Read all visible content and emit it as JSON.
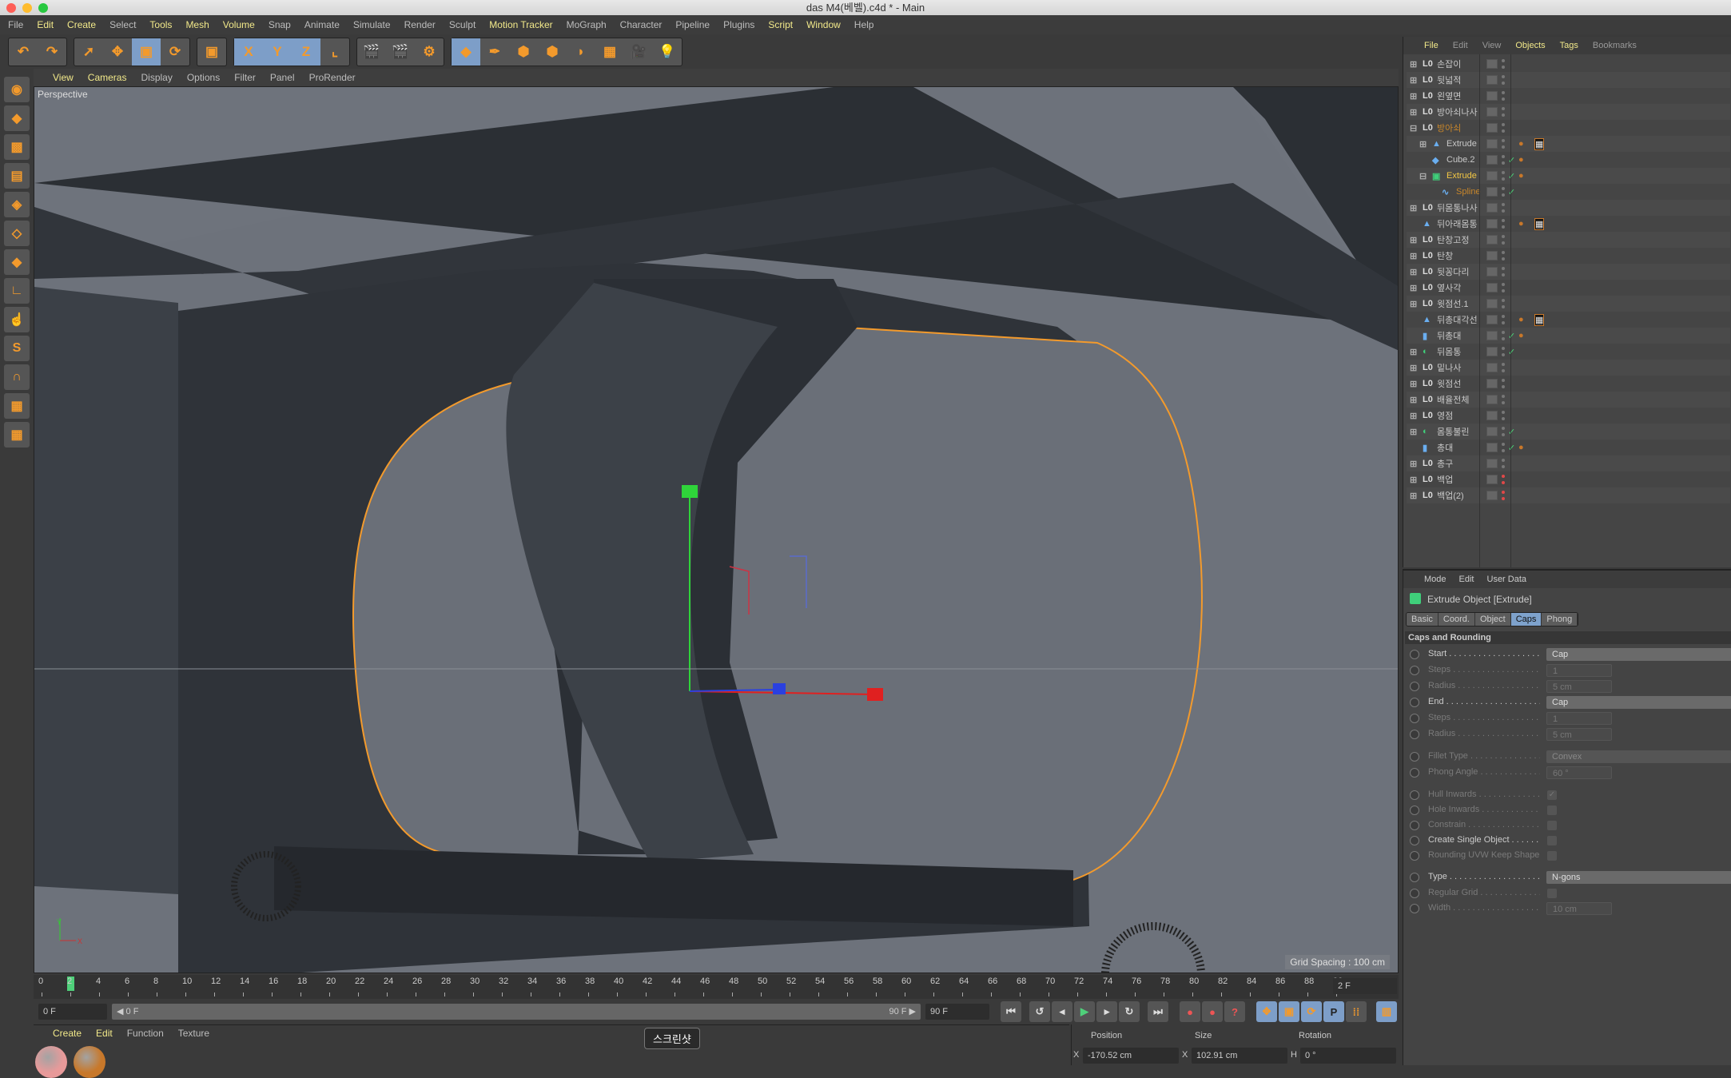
{
  "window": {
    "title": "das M4(베벨).c4d * - Main"
  },
  "menu": [
    {
      "label": "File",
      "hl": false
    },
    {
      "label": "Edit",
      "hl": true
    },
    {
      "label": "Create",
      "hl": true
    },
    {
      "label": "Select",
      "hl": false
    },
    {
      "label": "Tools",
      "hl": true
    },
    {
      "label": "Mesh",
      "hl": true
    },
    {
      "label": "Volume",
      "hl": true
    },
    {
      "label": "Snap",
      "hl": false
    },
    {
      "label": "Animate",
      "hl": false
    },
    {
      "label": "Simulate",
      "hl": false
    },
    {
      "label": "Render",
      "hl": false
    },
    {
      "label": "Sculpt",
      "hl": false
    },
    {
      "label": "Motion Tracker",
      "hl": true
    },
    {
      "label": "MoGraph",
      "hl": false
    },
    {
      "label": "Character",
      "hl": false
    },
    {
      "label": "Pipeline",
      "hl": false
    },
    {
      "label": "Plugins",
      "hl": false
    },
    {
      "label": "Script",
      "hl": true
    },
    {
      "label": "Window",
      "hl": true
    },
    {
      "label": "Help",
      "hl": false
    }
  ],
  "toolbar": {
    "groups": [
      [
        {
          "icon": "undo-icon",
          "g": "↶"
        },
        {
          "icon": "redo-icon",
          "g": "↷"
        }
      ],
      [
        {
          "icon": "live-selection-icon",
          "g": "➚"
        },
        {
          "icon": "move-icon",
          "g": "✥"
        },
        {
          "icon": "scale-icon",
          "g": "▣",
          "on": true
        },
        {
          "icon": "rotate-icon",
          "g": "⟳"
        }
      ],
      [
        {
          "icon": "recent-tool-icon",
          "g": "▣"
        }
      ],
      [
        {
          "icon": "x-axis-lock-icon",
          "g": "X",
          "on": true
        },
        {
          "icon": "y-axis-lock-icon",
          "g": "Y",
          "on": true
        },
        {
          "icon": "z-axis-lock-icon",
          "g": "Z",
          "on": true
        },
        {
          "icon": "coordinate-system-icon",
          "g": "⌞"
        }
      ],
      [
        {
          "icon": "render-view-icon",
          "g": "🎬"
        },
        {
          "icon": "render-picture-viewer-icon",
          "g": "🎬"
        },
        {
          "icon": "render-settings-icon",
          "g": "⚙"
        }
      ],
      [
        {
          "icon": "cube-object-icon",
          "g": "◆",
          "on": true
        },
        {
          "icon": "pen-spline-icon",
          "g": "✒"
        },
        {
          "icon": "subdivision-surface-icon",
          "g": "⬢"
        },
        {
          "icon": "cloner-icon",
          "g": "⬢"
        },
        {
          "icon": "deformer-icon",
          "g": "◗"
        },
        {
          "icon": "floor-icon",
          "g": "▦"
        },
        {
          "icon": "camera-icon",
          "g": "🎥"
        },
        {
          "icon": "light-icon",
          "g": "💡"
        }
      ]
    ]
  },
  "left_tools": [
    {
      "icon": "make-editable-icon",
      "g": "◉"
    },
    {
      "icon": "model-mode-icon",
      "g": "◆"
    },
    {
      "icon": "texture-mode-icon",
      "g": "▩"
    },
    {
      "icon": "workplane-icon",
      "g": "▤"
    },
    {
      "icon": "points-mode-icon",
      "g": "◈"
    },
    {
      "icon": "edges-mode-icon",
      "g": "◇"
    },
    {
      "icon": "polygons-mode-icon",
      "g": "◆"
    },
    {
      "icon": "axis-mode-icon",
      "g": "∟"
    },
    {
      "icon": "tweak-mode-icon",
      "g": "☝"
    },
    {
      "icon": "snap-icon",
      "g": "S"
    },
    {
      "icon": "magnet-icon",
      "g": "∩"
    },
    {
      "icon": "lock-workplane-icon",
      "g": "▦"
    },
    {
      "icon": "planar-workplane-icon",
      "g": "▦"
    }
  ],
  "viewport": {
    "menu": [
      {
        "label": "View",
        "hl": true
      },
      {
        "label": "Cameras",
        "hl": true
      },
      {
        "label": "Display",
        "hl": false
      },
      {
        "label": "Options",
        "hl": false
      },
      {
        "label": "Filter",
        "hl": false
      },
      {
        "label": "Panel",
        "hl": false
      },
      {
        "label": "ProRender",
        "hl": false
      }
    ],
    "label": "Perspective",
    "grid_spacing": "Grid Spacing : 100 cm",
    "axis_y": "Y",
    "axis_x": "X"
  },
  "timeline": {
    "ticks": [
      "0",
      "2",
      "4",
      "6",
      "8",
      "10",
      "12",
      "14",
      "16",
      "18",
      "20",
      "22",
      "24",
      "26",
      "28",
      "30",
      "32",
      "34",
      "36",
      "38",
      "40",
      "42",
      "44",
      "46",
      "48",
      "50",
      "52",
      "54",
      "56",
      "58",
      "60",
      "62",
      "64",
      "66",
      "68",
      "70",
      "72",
      "74",
      "76",
      "78",
      "80",
      "82",
      "84",
      "86",
      "88",
      "90"
    ],
    "current_frame": 2,
    "max_frame": 90,
    "frame_field": "2 F"
  },
  "controls": {
    "start_field": "0 F",
    "range_start": "◀ 0 F",
    "range_end": "90 F ▶",
    "end_field": "90 F"
  },
  "materials": {
    "menu": [
      {
        "label": "Create",
        "hl": true
      },
      {
        "label": "Edit",
        "hl": true
      },
      {
        "label": "Function",
        "hl": false
      },
      {
        "label": "Texture",
        "hl": false
      }
    ],
    "swatches": [
      "#e89a9a",
      "#c8782a"
    ]
  },
  "tooltip": "스크린샷",
  "coords": {
    "headers": [
      "Position",
      "Size",
      "Rotation"
    ],
    "x_label": "X",
    "x_position": "-170.52 cm",
    "x_size": "102.91 cm",
    "h_label": "H",
    "h_rotation": "0 °"
  },
  "object_manager": {
    "menu": [
      {
        "label": "File",
        "hl": true
      },
      {
        "label": "Edit",
        "hl": false
      },
      {
        "label": "View",
        "hl": false
      },
      {
        "label": "Objects",
        "hl": true
      },
      {
        "label": "Tags",
        "hl": true
      },
      {
        "label": "Bookmarks",
        "hl": false
      }
    ],
    "objects": [
      {
        "name": "손잡이",
        "icon": "null-icon",
        "depth": 0,
        "expand": "+"
      },
      {
        "name": "뒷넓적",
        "icon": "null-icon",
        "depth": 0,
        "expand": "+"
      },
      {
        "name": "왼옆면",
        "icon": "null-icon",
        "depth": 0,
        "expand": "+"
      },
      {
        "name": "방아쇠나사",
        "icon": "null-icon",
        "depth": 0,
        "expand": "+"
      },
      {
        "name": "방아쇠",
        "icon": "null-icon",
        "depth": 0,
        "expand": "-",
        "color": "#c8862a"
      },
      {
        "name": "Extrude",
        "icon": "polygon-object-icon",
        "depth": 1,
        "expand": "+",
        "tags": [
          "material-tag-icon",
          "texture-tag-icon"
        ]
      },
      {
        "name": "Cube.2",
        "icon": "cube-icon",
        "depth": 1,
        "check": true,
        "tags": [
          "material-tag-icon"
        ]
      },
      {
        "name": "Extrude",
        "icon": "extrude-icon",
        "depth": 1,
        "expand": "-",
        "check": true,
        "color": "#f2c744",
        "tags": [
          "material-tag-icon"
        ]
      },
      {
        "name": "Spline",
        "icon": "spline-icon",
        "depth": 2,
        "check": true,
        "color": "#c8862a"
      },
      {
        "name": "뒤몸통나사",
        "icon": "null-icon",
        "depth": 0,
        "expand": "+"
      },
      {
        "name": "뒤아래몸통",
        "icon": "polygon-object-icon",
        "depth": 0,
        "tags": [
          "material-tag-icon",
          "texture-tag-icon"
        ]
      },
      {
        "name": "탄창고정",
        "icon": "null-icon",
        "depth": 0,
        "expand": "+"
      },
      {
        "name": "탄창",
        "icon": "null-icon",
        "depth": 0,
        "expand": "+"
      },
      {
        "name": "뒷꽁다리",
        "icon": "null-icon",
        "depth": 0,
        "expand": "+"
      },
      {
        "name": "옆사각",
        "icon": "null-icon",
        "depth": 0,
        "expand": "+"
      },
      {
        "name": "윗점선.1",
        "icon": "null-icon",
        "depth": 0,
        "expand": "+"
      },
      {
        "name": "뒤총대각선",
        "icon": "polygon-object-icon",
        "depth": 0,
        "tags": [
          "material-tag-icon",
          "texture-tag-icon"
        ]
      },
      {
        "name": "뒤총대",
        "icon": "cylinder-icon",
        "depth": 0,
        "check": true,
        "tags": [
          "material-tag-icon"
        ]
      },
      {
        "name": "뒤몸통",
        "icon": "boole-icon",
        "depth": 0,
        "expand": "+",
        "check": true
      },
      {
        "name": "밑나사",
        "icon": "null-icon",
        "depth": 0,
        "expand": "+"
      },
      {
        "name": "윗점선",
        "icon": "null-icon",
        "depth": 0,
        "expand": "+"
      },
      {
        "name": "배율전체",
        "icon": "null-icon",
        "depth": 0,
        "expand": "+"
      },
      {
        "name": "영점",
        "icon": "null-icon",
        "depth": 0,
        "expand": "+"
      },
      {
        "name": "몸통불린",
        "icon": "boole-icon",
        "depth": 0,
        "expand": "+",
        "check": true
      },
      {
        "name": "총대",
        "icon": "cylinder-icon",
        "depth": 0,
        "check": true,
        "tags": [
          "material-tag-icon"
        ]
      },
      {
        "name": "총구",
        "icon": "null-icon",
        "depth": 0,
        "expand": "+"
      },
      {
        "name": "백업",
        "icon": "null-icon",
        "depth": 0,
        "expand": "+",
        "hidden": true
      },
      {
        "name": "백업(2)",
        "icon": "null-icon",
        "depth": 0,
        "expand": "+",
        "hidden": true
      }
    ]
  },
  "attributes": {
    "menu": [
      "Mode",
      "Edit",
      "User Data"
    ],
    "title": "Extrude Object [Extrude]",
    "tabs": [
      {
        "label": "Basic"
      },
      {
        "label": "Coord."
      },
      {
        "label": "Object"
      },
      {
        "label": "Caps",
        "on": true
      },
      {
        "label": "Phong"
      }
    ],
    "section": "Caps and Rounding",
    "params": [
      {
        "label": "Start",
        "value": "Cap",
        "kind": "dropdown",
        "enabled": true
      },
      {
        "label": "Steps",
        "value": "1",
        "kind": "spinner",
        "enabled": false
      },
      {
        "label": "Radius",
        "value": "5 cm",
        "kind": "spinner",
        "enabled": false
      },
      {
        "label": "End",
        "value": "Cap",
        "kind": "dropdown",
        "enabled": true
      },
      {
        "label": "Steps",
        "value": "1",
        "kind": "spinner",
        "enabled": false
      },
      {
        "label": "Radius",
        "value": "5 cm",
        "kind": "spinner",
        "enabled": false
      },
      {
        "label": "Fillet Type",
        "value": "Convex",
        "kind": "dropdown",
        "enabled": false,
        "gap": true
      },
      {
        "label": "Phong Angle",
        "value": "60 °",
        "kind": "spinner",
        "enabled": false
      },
      {
        "label": "Hull Inwards",
        "kind": "checkbox",
        "checked": true,
        "enabled": false,
        "gap": true
      },
      {
        "label": "Hole Inwards",
        "kind": "checkbox",
        "checked": false,
        "enabled": false
      },
      {
        "label": "Constrain",
        "kind": "checkbox",
        "checked": false,
        "enabled": false
      },
      {
        "label": "Create Single Object",
        "kind": "checkbox",
        "checked": false,
        "enabled": true
      },
      {
        "label": "Rounding UVW Keep Shape",
        "kind": "checkbox",
        "checked": false,
        "enabled": false
      },
      {
        "label": "Type",
        "value": "N-gons",
        "kind": "dropdown",
        "enabled": true,
        "gap": true
      },
      {
        "label": "Regular Grid",
        "kind": "checkbox",
        "checked": false,
        "enabled": false
      },
      {
        "label": "Width",
        "value": "10 cm",
        "kind": "spinner",
        "enabled": false
      }
    ]
  },
  "colors": {
    "accent_yellow": "#f2e98a",
    "selected_tab": "#7ea2cc",
    "viewport_bg": "#6d727b",
    "selection_outline": "#f39a2c",
    "playhead": "#4fd07a"
  }
}
